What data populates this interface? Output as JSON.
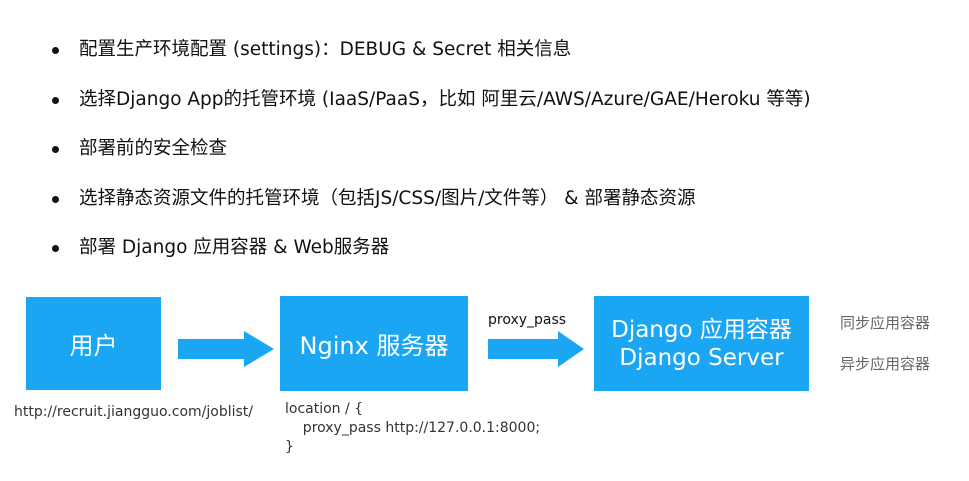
{
  "bullets": [
    "配置生产环境配置 (settings)：DEBUG & Secret 相关信息",
    "选择Django App的托管环境 (IaaS/PaaS，比如 阿里云/AWS/Azure/GAE/Heroku 等等)",
    "部署前的安全检查",
    "选择静态资源文件的托管环境（包括JS/CSS/图片/文件等） & 部署静态资源",
    "部署 Django 应用容器 & Web服务器"
  ],
  "diagram": {
    "user_box": "用户",
    "nginx_box": "Nginx 服务器",
    "django_box_line1": "Django 应用容器",
    "django_box_line2": "Django Server",
    "proxy_label": "proxy_pass",
    "url": "http://recruit.jiangguo.com/joblist/",
    "code": [
      "location / {",
      "    proxy_pass http://127.0.0.1:8000;",
      "}"
    ],
    "side_notes": [
      "同步应用容器",
      "异步应用容器"
    ],
    "colors": {
      "box": "#1aa6f2",
      "arrow": "#1aa6f2"
    }
  }
}
